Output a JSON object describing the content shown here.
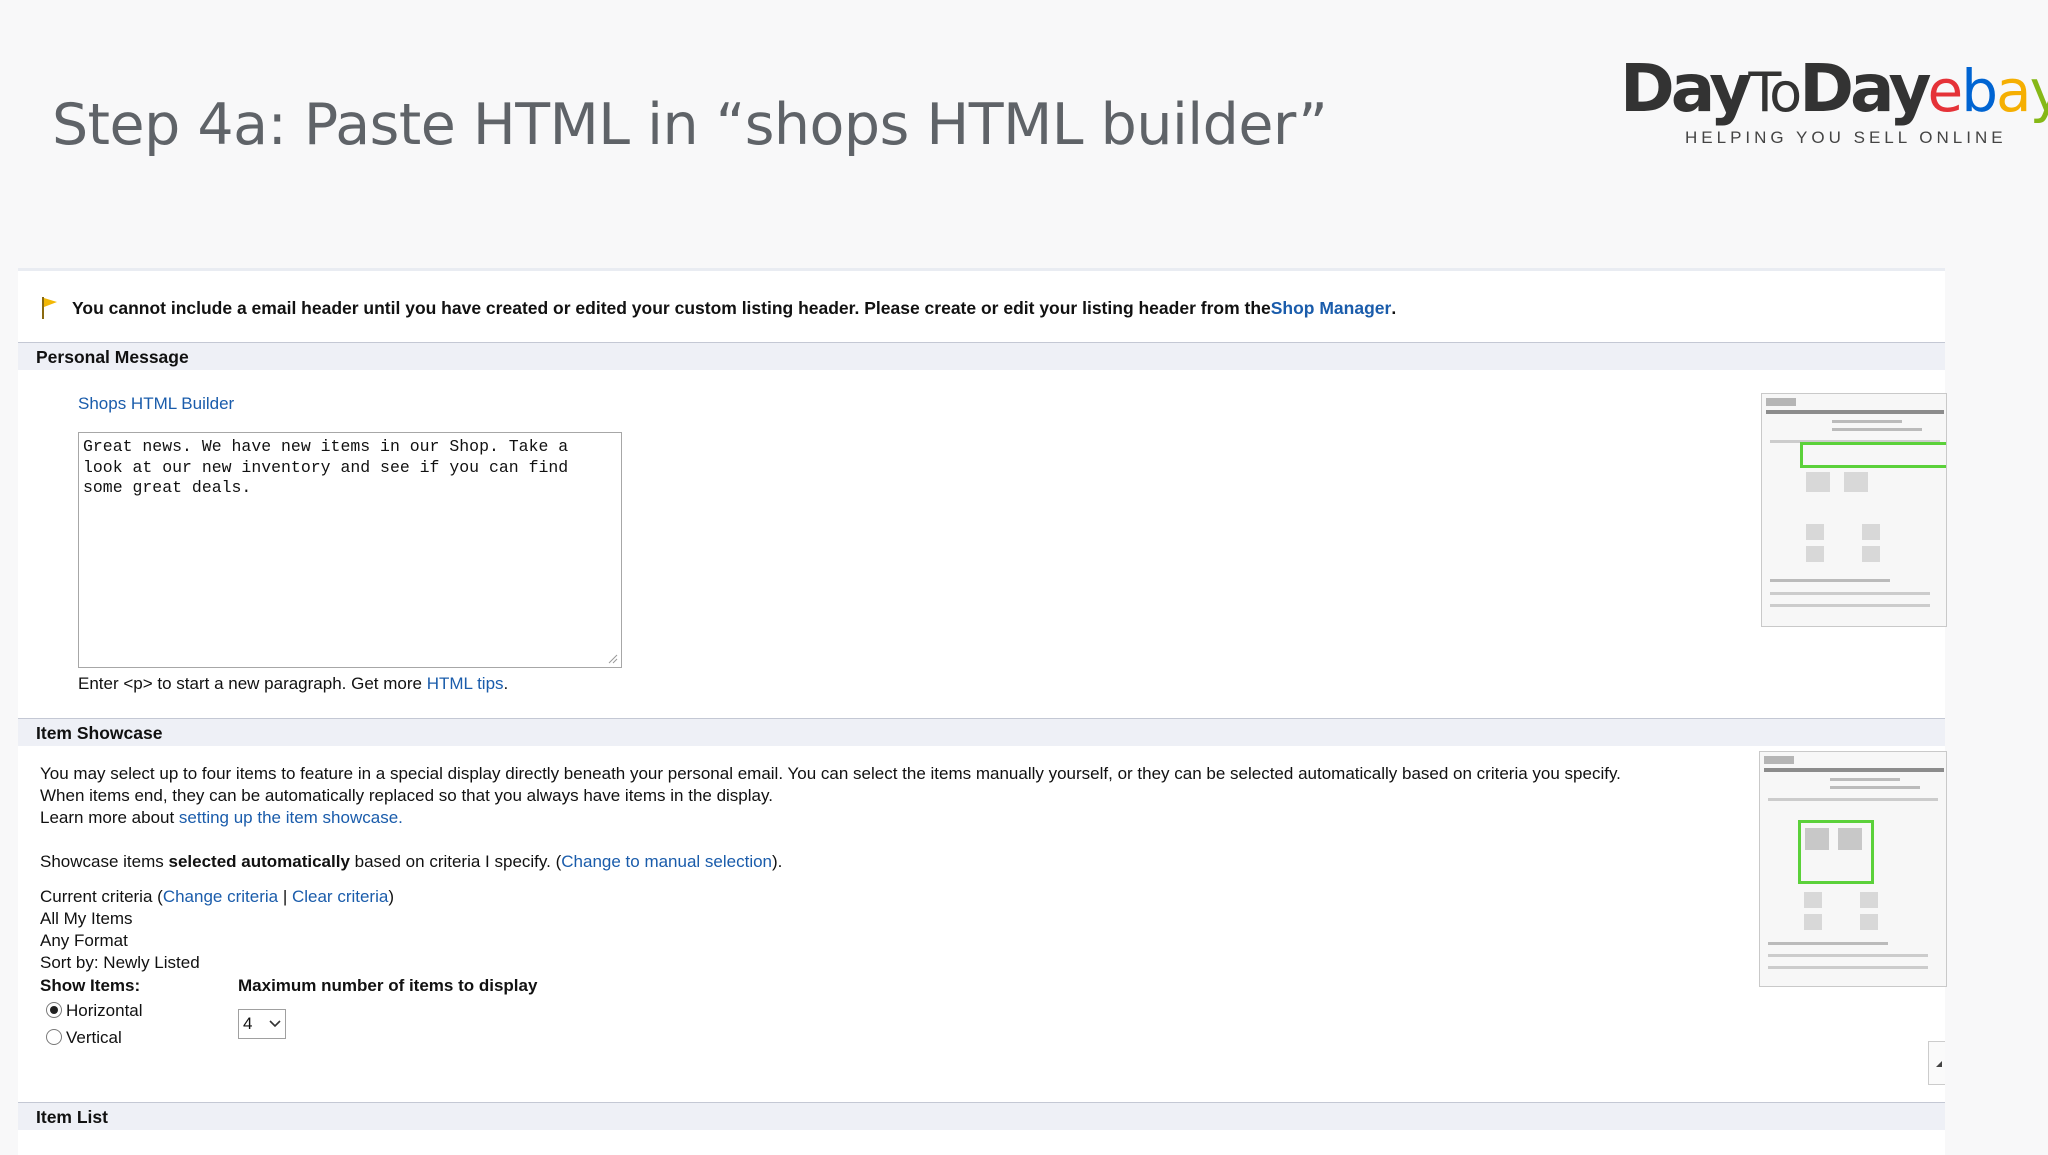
{
  "slide": {
    "title": "Step 4a: Paste HTML in “shops HTML builder”"
  },
  "logo": {
    "day1": "Day",
    "to": "To",
    "day2": "Day",
    "ebay_e": "e",
    "ebay_b": "b",
    "ebay_a": "a",
    "ebay_y": "y",
    "tagline": "HELPING YOU SELL ONLINE",
    "colors": {
      "dark": "#333333",
      "e": "#e53238",
      "b": "#0064d2",
      "a": "#f5af02",
      "y": "#86b817"
    }
  },
  "notice": {
    "icon": "flag-icon",
    "text": "You cannot include a email header until you have created or edited your custom listing header. Please create or edit your listing header from the ",
    "link": "Shop Manager",
    "end": "."
  },
  "personal_message": {
    "heading": "Personal Message",
    "builder_link": "Shops HTML Builder",
    "textarea_value": "Great news. We have new items in our Shop. Take a look at our new inventory and see if you can find some great deals.",
    "hint_pre": "Enter <p> to start a new paragraph. Get more ",
    "hint_link": "HTML tips",
    "hint_post": "."
  },
  "item_showcase": {
    "heading": "Item Showcase",
    "desc_line1": "You may select up to four items to feature in a special display directly beneath your personal email. You can select the items manually yourself, or they can be selected automatically based on criteria you specify.",
    "desc_line2": "When items end, they can be automatically replaced so that you always have items in the display.",
    "learn_pre": "Learn more about ",
    "learn_link": "setting up the item showcase.",
    "mode_pre": "Showcase items ",
    "mode_bold": "selected automatically",
    "mode_mid": " based on criteria I specify. (",
    "mode_link": "Change to manual selection",
    "mode_post": ").",
    "criteria_pre": "Current criteria (",
    "change_criteria": "Change criteria",
    "criteria_sep": " | ",
    "clear_criteria": "Clear criteria",
    "criteria_post": ")",
    "criteria_items": [
      "All My Items",
      "Any Format",
      "Sort by: Newly Listed"
    ],
    "show_items_label": "Show Items:",
    "orientation_options": [
      {
        "label": "Horizontal",
        "checked": true
      },
      {
        "label": "Vertical",
        "checked": false
      }
    ],
    "max_items_label": "Maximum number of items to display",
    "max_items_value": "4"
  },
  "item_list": {
    "heading": "Item List"
  }
}
